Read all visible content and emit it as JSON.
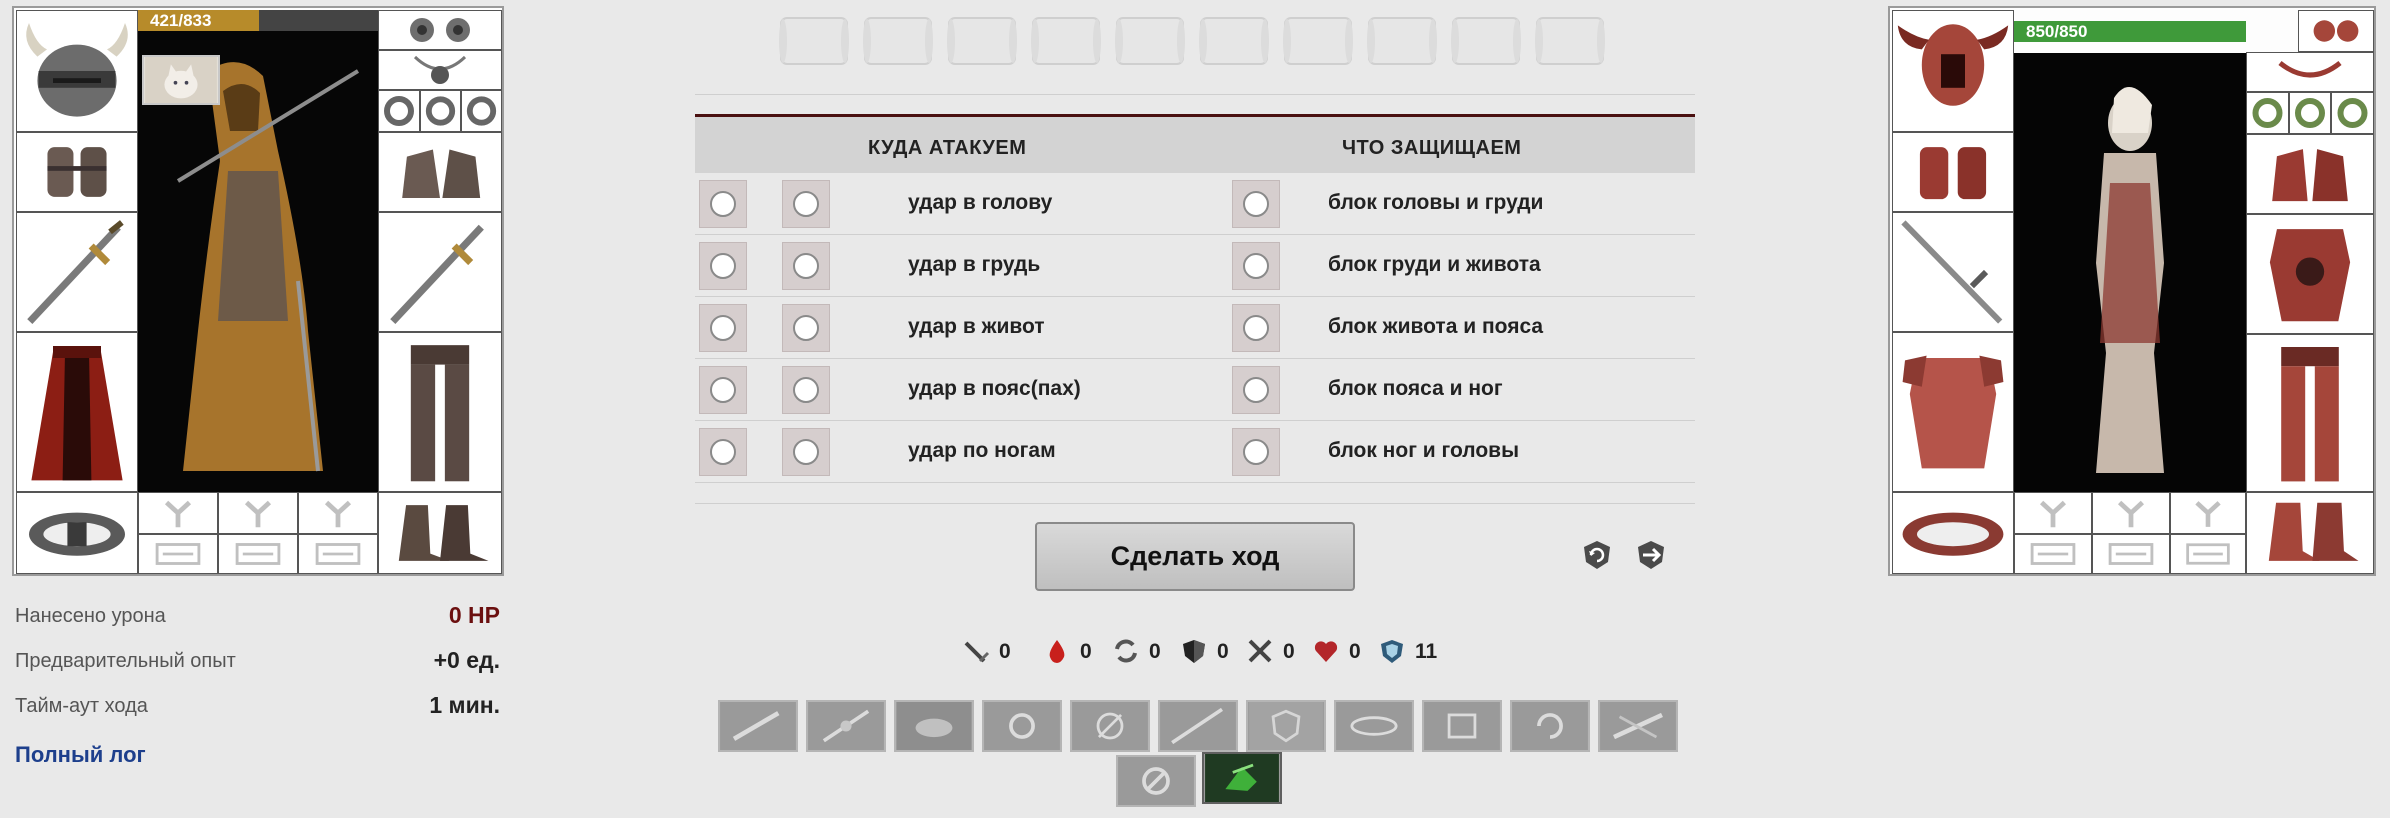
{
  "player": {
    "hp": "421/833",
    "hp_fraction": 0.505,
    "hp_color": "#b78b2a"
  },
  "enemy": {
    "hp": "850/850",
    "hp_fraction": 1.0,
    "hp_color": "#3f9a3a"
  },
  "stats": {
    "damage_label": "Нанесено урона",
    "damage_value": "0 HP",
    "exp_label": "Предварительный опыт",
    "exp_value": "+0 ед.",
    "timeout_label": "Тайм-аут хода",
    "timeout_value": "1 мин.",
    "log_link": "Полный лог"
  },
  "combat": {
    "attack_header": "КУДА АТАКУЕМ",
    "defend_header": "ЧТО ЗАЩИЩАЕМ",
    "rows": [
      {
        "attack": "удар в голову",
        "defend": "блок головы и груди"
      },
      {
        "attack": "удар в грудь",
        "defend": "блок груди и живота"
      },
      {
        "attack": "удар в живот",
        "defend": "блок живота и пояса"
      },
      {
        "attack": "удар в пояс(пах)",
        "defend": "блок пояса и ног"
      },
      {
        "attack": "удар по ногам",
        "defend": "блок ног и головы"
      }
    ],
    "submit_label": "Сделать ход"
  },
  "counters": [
    {
      "icon": "sword-hit-icon",
      "value": "0"
    },
    {
      "icon": "blood-drop-icon",
      "value": "0"
    },
    {
      "icon": "counter-attack-icon",
      "value": "0"
    },
    {
      "icon": "block-shield-icon",
      "value": "0"
    },
    {
      "icon": "crossed-swords-icon",
      "value": "0"
    },
    {
      "icon": "heart-icon",
      "value": "0"
    },
    {
      "icon": "spirit-shield-icon",
      "value": "11"
    }
  ],
  "colors": {
    "accent_dark_red": "#4a1010",
    "link_blue": "#1d3f8c",
    "damage_red": "#6b0f0f"
  }
}
